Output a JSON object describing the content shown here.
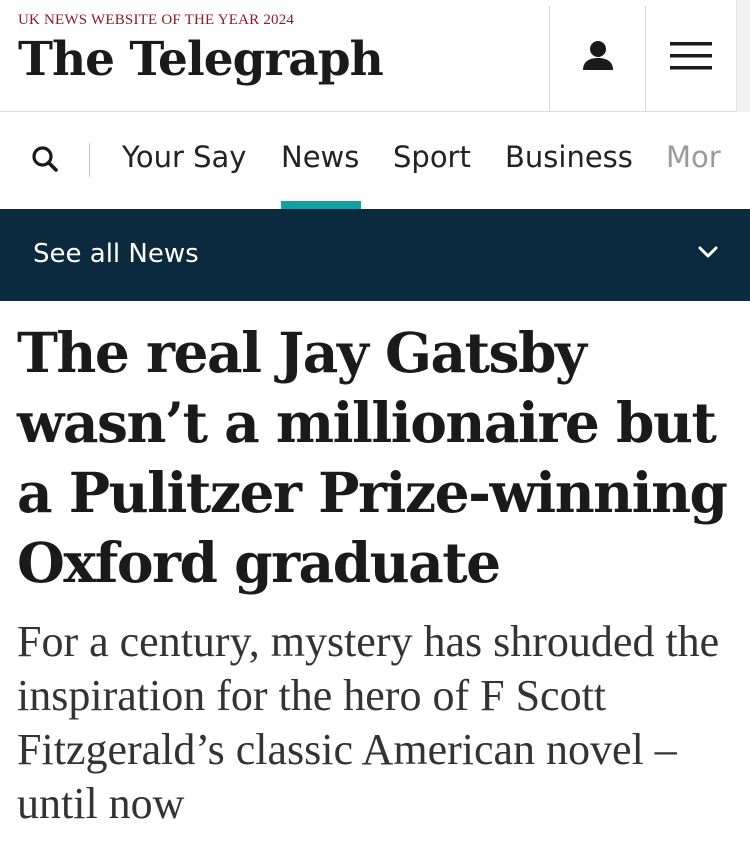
{
  "masthead": {
    "award": "UK NEWS WEBSITE OF THE YEAR 2024",
    "logo": "The Telegraph",
    "account_icon": "person-icon",
    "menu_icon": "hamburger-menu-icon"
  },
  "nav": {
    "search_icon": "search-icon",
    "items": [
      {
        "label": "Your Say"
      },
      {
        "label": "News"
      },
      {
        "label": "Sport"
      },
      {
        "label": "Business"
      },
      {
        "label": "Mor"
      }
    ],
    "active": "News",
    "accent_color": "#13a1a0"
  },
  "section_bar": {
    "label": "See all News",
    "icon": "chevron-down-icon",
    "background": "#0c2a3e"
  },
  "article": {
    "headline": "The real Jay Gatsby wasn’t a millionaire but a Pulitzer Prize-winning Oxford graduate",
    "standfirst": "For a century, mystery has shrouded the inspiration for the hero of F Scott Fitzgerald’s classic American novel – until now"
  }
}
